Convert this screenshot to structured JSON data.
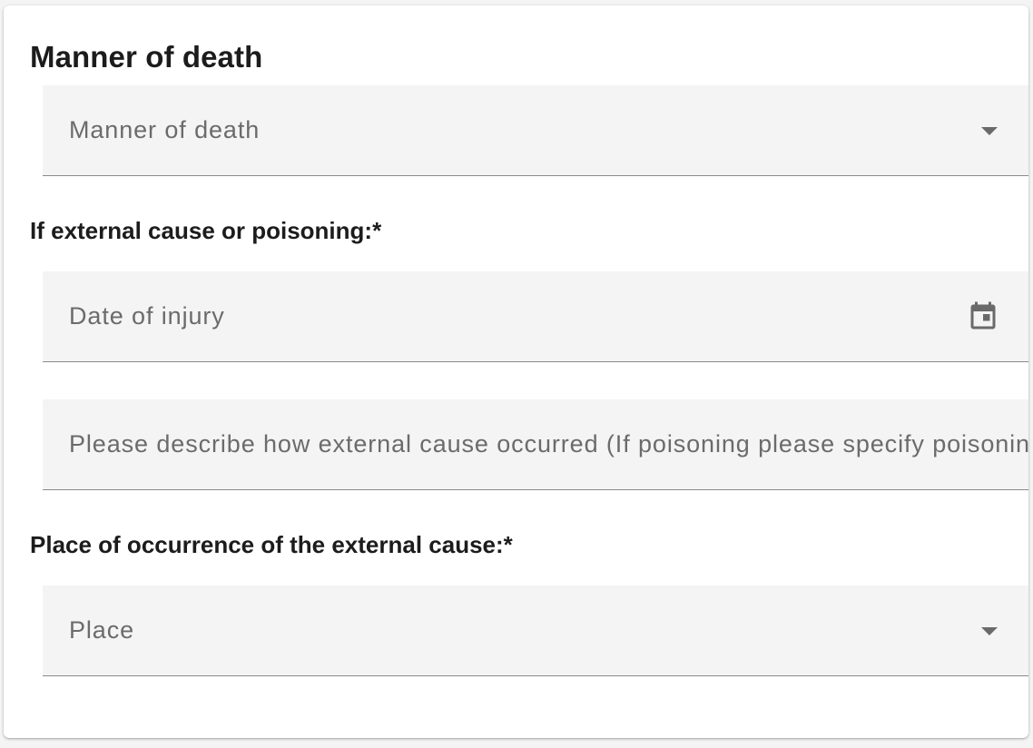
{
  "section": {
    "title": "Manner of death"
  },
  "manner_select": {
    "label": "Manner of death",
    "icon": "chevron-down-icon"
  },
  "external_cause": {
    "heading": "If external cause or poisoning:*",
    "date_field": {
      "label": "Date of injury",
      "icon": "calendar-icon"
    },
    "description_field": {
      "label": "Please describe how external cause occurred (If poisoning please specify poisoning agent)"
    }
  },
  "place": {
    "heading": "Place of occurrence of the external cause:*",
    "select": {
      "label": "Place",
      "icon": "chevron-down-icon"
    }
  },
  "colors": {
    "field_bg": "#f4f4f4",
    "field_border": "#8a8a8a",
    "label_text": "#6b6b6b",
    "heading_text": "#1c1c1c"
  }
}
